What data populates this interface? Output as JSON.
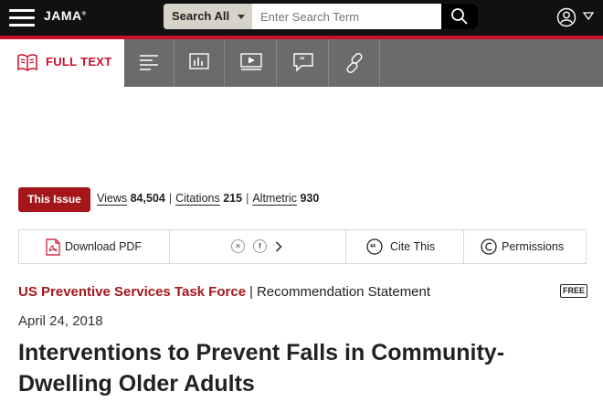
{
  "header": {
    "logo": "JAMA",
    "logo_mark": "®",
    "search": {
      "scope": "Search All",
      "placeholder": "Enter Search Term"
    }
  },
  "tabs": [
    {
      "label": "FULL TEXT",
      "icon": "book-icon",
      "active": true
    },
    {
      "label": "",
      "icon": "outline-icon"
    },
    {
      "label": "",
      "icon": "figures-icon"
    },
    {
      "label": "",
      "icon": "video-icon"
    },
    {
      "label": "",
      "icon": "comments-icon"
    },
    {
      "label": "",
      "icon": "link-icon"
    }
  ],
  "issue": {
    "button": "This Issue",
    "views_label": "Views",
    "views": "84,504",
    "citations_label": "Citations",
    "citations": "215",
    "altmetric_label": "Altmetric",
    "altmetric": "930"
  },
  "actions": {
    "download": "Download PDF",
    "cite": "Cite This",
    "permissions": "Permissions"
  },
  "article": {
    "category": "US Preventive Services Task Force",
    "type": "Recommendation Statement",
    "badge": "FREE",
    "date": "April 24, 2018",
    "title": "Interventions to Prevent Falls in Community-Dwelling Older Adults"
  },
  "colors": {
    "brand_red": "#c8102e",
    "issue_red": "#a4161a",
    "header_bg": "#111111",
    "tabbar_bg": "#6b6b6b"
  }
}
